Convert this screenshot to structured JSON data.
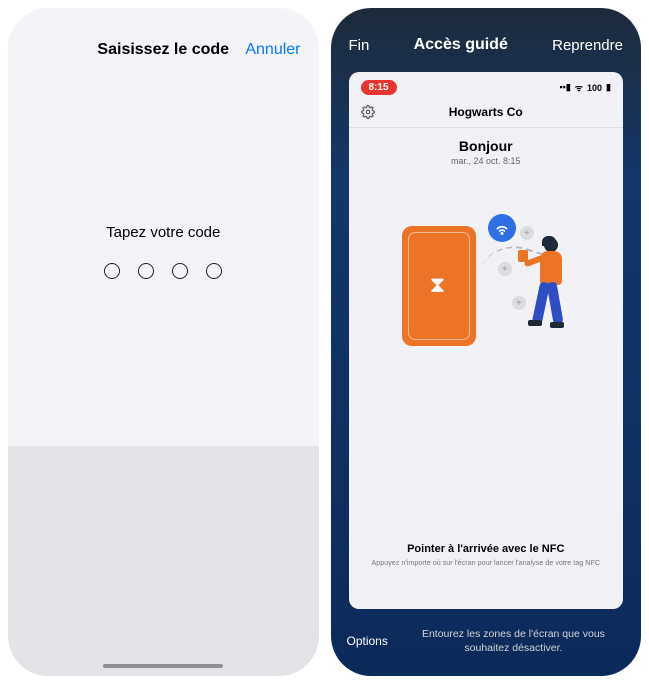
{
  "left": {
    "title": "Saisissez le code",
    "cancel": "Annuler",
    "prompt": "Tapez votre code"
  },
  "right": {
    "header": {
      "end": "Fin",
      "title": "Accès guidé",
      "resume": "Reprendre"
    },
    "preview": {
      "statusbar": {
        "time": "8:15",
        "battery": "100"
      },
      "gear_icon": "gear",
      "company": "Hogwarts Co",
      "greeting": {
        "title": "Bonjour",
        "date": "mar., 24 oct. 8:15"
      },
      "nfc": {
        "title": "Pointer à l'arrivée avec le NFC",
        "sub": "Appuyez n'importe où sur l'écran pour lancer l'analyse de votre tag NFC"
      }
    },
    "bottom": {
      "options": "Options",
      "hint": "Entourez les zones de l'écran que vous souhaitez désactiver."
    }
  }
}
